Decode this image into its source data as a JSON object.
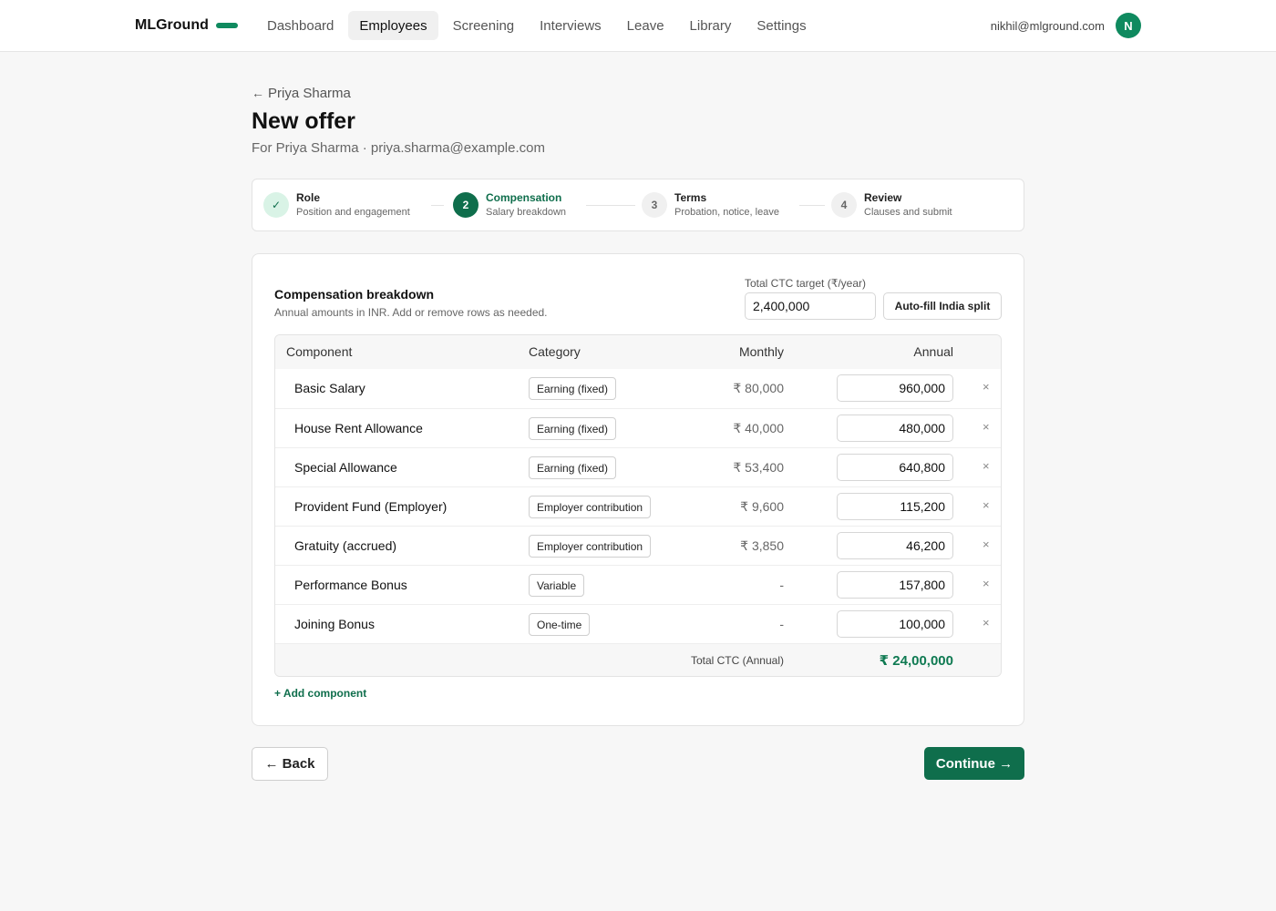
{
  "header": {
    "brand": "MLGround",
    "nav": [
      "Dashboard",
      "Employees",
      "Screening",
      "Interviews",
      "Leave",
      "Library",
      "Settings"
    ],
    "active_nav": "Employees",
    "user_email": "nikhil@mlground.com",
    "avatar_initial": "N"
  },
  "page": {
    "breadcrumb_arrow": "←",
    "breadcrumb": "Priya Sharma",
    "title": "New offer",
    "subtitle": "For Priya Sharma · priya.sharma@example.com"
  },
  "stepper": {
    "steps": [
      {
        "marker": "✓",
        "title": "Role",
        "desc": "Position and engagement",
        "state": "done"
      },
      {
        "marker": "2",
        "title": "Compensation",
        "desc": "Salary breakdown",
        "state": "current"
      },
      {
        "marker": "3",
        "title": "Terms",
        "desc": "Probation, notice, leave",
        "state": "todo"
      },
      {
        "marker": "4",
        "title": "Review",
        "desc": "Clauses and submit",
        "state": "todo"
      }
    ]
  },
  "compensation": {
    "title": "Compensation breakdown",
    "subtitle": "Annual amounts in INR. Add or remove rows as needed.",
    "ctc_label": "Total CTC target (₹/year)",
    "ctc_value": "2,400,000",
    "autofill_label": "Auto-fill India split",
    "columns": {
      "component": "Component",
      "category": "Category",
      "monthly": "Monthly",
      "annual": "Annual"
    },
    "rows": [
      {
        "component": "Basic Salary",
        "category": "Earning (fixed)",
        "monthly": "₹ 80,000",
        "annual": "960,000",
        "remove": "×"
      },
      {
        "component": "House Rent Allowance",
        "category": "Earning (fixed)",
        "monthly": "₹ 40,000",
        "annual": "480,000",
        "remove": "×"
      },
      {
        "component": "Special Allowance",
        "category": "Earning (fixed)",
        "monthly": "₹ 53,400",
        "annual": "640,800",
        "remove": "×"
      },
      {
        "component": "Provident Fund (Employer)",
        "category": "Employer contribution",
        "monthly": "₹ 9,600",
        "annual": "115,200",
        "remove": "×"
      },
      {
        "component": "Gratuity (accrued)",
        "category": "Employer contribution",
        "monthly": "₹ 3,850",
        "annual": "46,200",
        "remove": "×"
      },
      {
        "component": "Performance Bonus",
        "category": "Variable",
        "monthly": "-",
        "annual": "157,800",
        "remove": "×"
      },
      {
        "component": "Joining Bonus",
        "category": "One-time",
        "monthly": "-",
        "annual": "100,000",
        "remove": "×"
      }
    ],
    "total_label": "Total CTC (Annual)",
    "total_value": "₹ 24,00,000",
    "add_label": "+ Add component"
  },
  "actions": {
    "back": "← Back",
    "continue": "Continue →"
  }
}
